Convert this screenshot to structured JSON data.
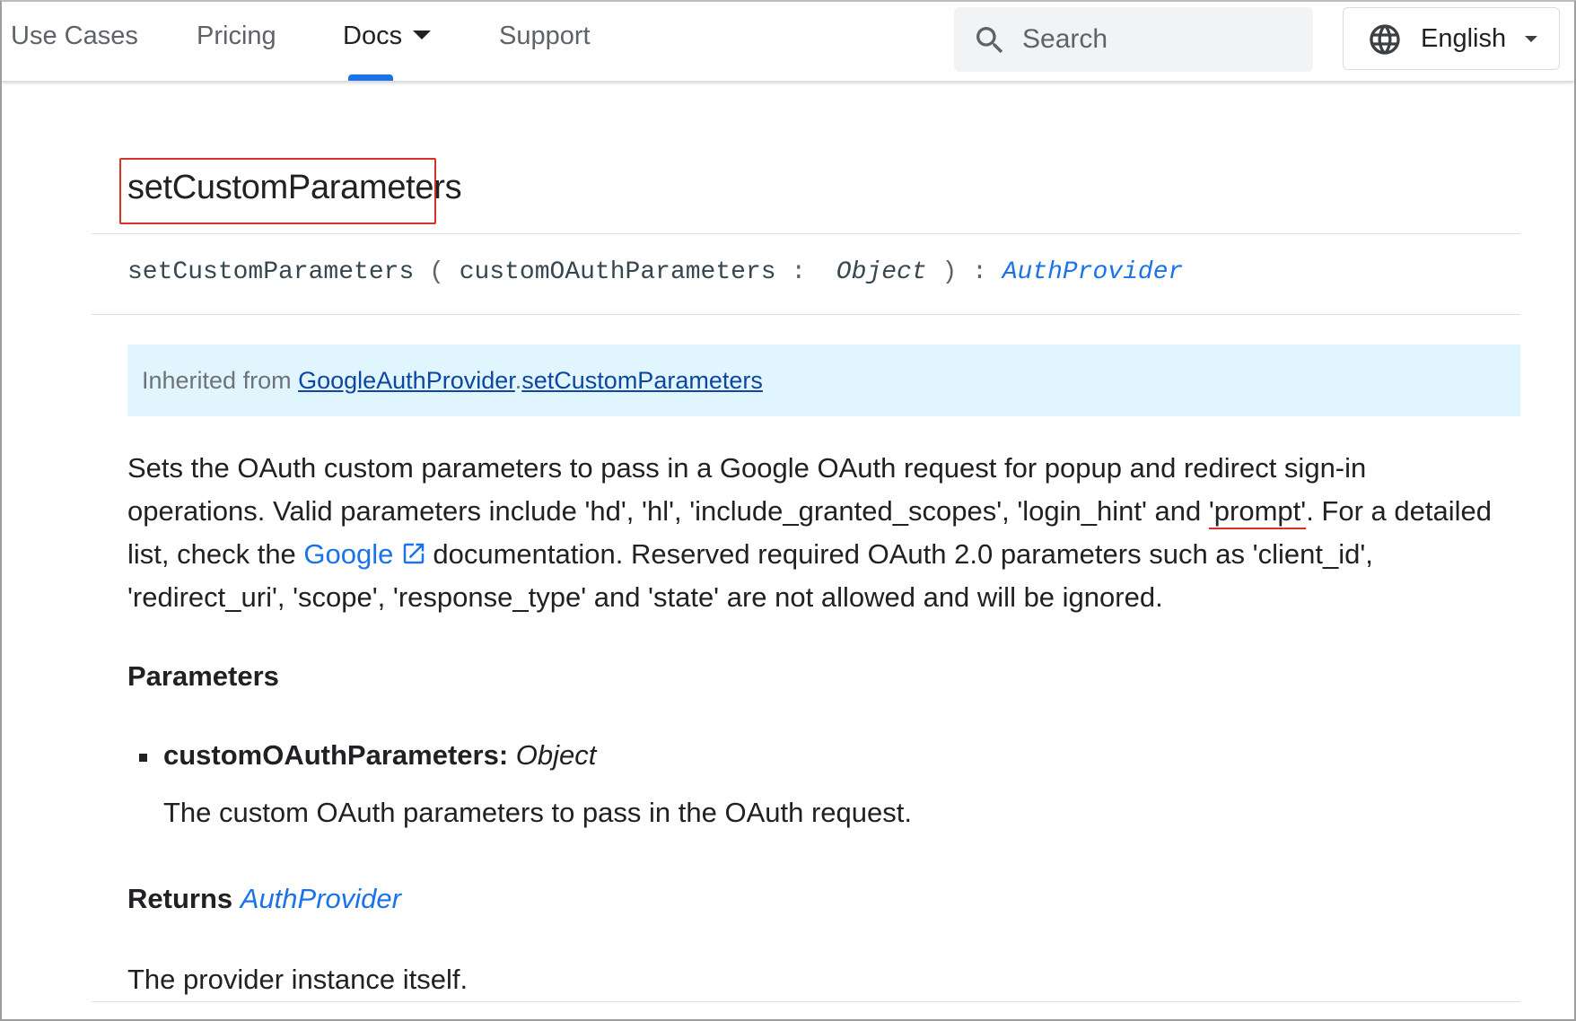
{
  "nav": {
    "items": [
      {
        "label": "Use Cases"
      },
      {
        "label": "Pricing"
      },
      {
        "label": "Docs"
      },
      {
        "label": "Support"
      }
    ],
    "active": "Docs",
    "search_placeholder": "Search",
    "language": "English",
    "accent_color": "#1a73e8"
  },
  "method": {
    "title": "setCustomParameters",
    "signature": {
      "name": "setCustomParameters",
      "open_paren": "(",
      "param": "customOAuthParameters",
      "colon": ":",
      "param_type": "Object",
      "close_paren": ")",
      "return_colon": ":",
      "return_type": "AuthProvider"
    },
    "inherited": {
      "prefix": "Inherited from",
      "class_link": "GoogleAuthProvider",
      "dot": ".",
      "method_link": "setCustomParameters"
    },
    "description": {
      "line1": "Sets the OAuth custom parameters to pass in a Google OAuth request for popup and redirect sign-in",
      "line2_a": "operations. Valid parameters include 'hd', 'hl', 'include_granted_scopes', 'login_hint' and ",
      "line2_highlight": "'prompt'",
      "line2_b": ". For a detailed",
      "line3_a": "list, check the ",
      "line3_link": "Google",
      "line3_b": "documentation. Reserved required OAuth 2.0 parameters such as 'client_id',",
      "line4": "'redirect_uri', 'scope', 'response_type' and 'state' are not allowed and will be ignored."
    },
    "parameters_heading": "Parameters",
    "parameters": [
      {
        "name": "customOAuthParameters:",
        "type": "Object",
        "description": "The custom OAuth parameters to pass in the OAuth request."
      }
    ],
    "returns_label": "Returns",
    "returns_type": "AuthProvider",
    "returns_description": "The provider instance itself."
  },
  "colors": {
    "highlight_box": "#d93025",
    "note_background": "#e1f5fe",
    "link": "#1a73e8"
  }
}
